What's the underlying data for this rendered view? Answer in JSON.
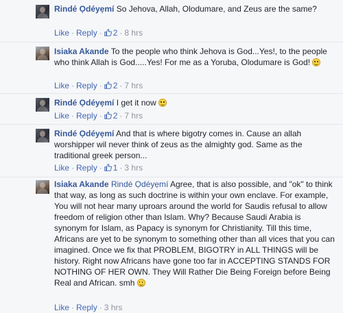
{
  "comments": [
    {
      "author": "Rindé Ọdéyẹmí",
      "text": "So Jehova, Allah, Olodumare, and Zeus are the same?",
      "like_label": "Like",
      "reply_label": "Reply",
      "likes": "2",
      "time": "8 hrs"
    },
    {
      "author": "Isiaka Akande",
      "text": "To the people who think Jehova is God...Yes!, to the people who think Allah is God.....Yes! For me as a Yoruba, Olodumare is God!",
      "like_label": "Like",
      "reply_label": "Reply",
      "likes": "2",
      "time": "7 hrs"
    },
    {
      "author": "Rindé Ọdéyẹmí",
      "text": "I get it now",
      "like_label": "Like",
      "reply_label": "Reply",
      "likes": "2",
      "time": "7 hrs"
    },
    {
      "author": "Rindé Ọdéyẹmí",
      "text": "And that is where bigotry comes in. Cause an allah worshipper wil never think of zeus as the almighty god. Same as the traditional greek person...",
      "like_label": "Like",
      "reply_label": "Reply",
      "likes": "1",
      "time": "3 hrs"
    },
    {
      "author": "Isiaka Akande",
      "mention": "Rindé Ọdéyẹmí",
      "text": "Agree, that is also possible, and \"ok\" to think that way, as long as such doctrine is within your own enclave. For example, You will not hear many uproars around the world for Saudis refusal to allow freedom of religion other than Islam. Why? Because Saudi Arabia is synonym for Islam, as Papacy is synonym for Christianity. Till this time, Africans are yet to be synonym to something other than all vices that you can imagined. Once we fix that PROBLEM, BIGOTRY in ALL THINGS will be history. Right now Africans have gone too far in ACCEPTING STANDS FOR NOTHING OF HER OWN. They Will Rather Die Being Foreign before Being Real and African. smh",
      "like_label": "Like",
      "reply_label": "Reply",
      "time": "3 hrs"
    }
  ],
  "colors": {
    "link": "#365899",
    "action": "#4267b2",
    "meta": "#90949c"
  }
}
